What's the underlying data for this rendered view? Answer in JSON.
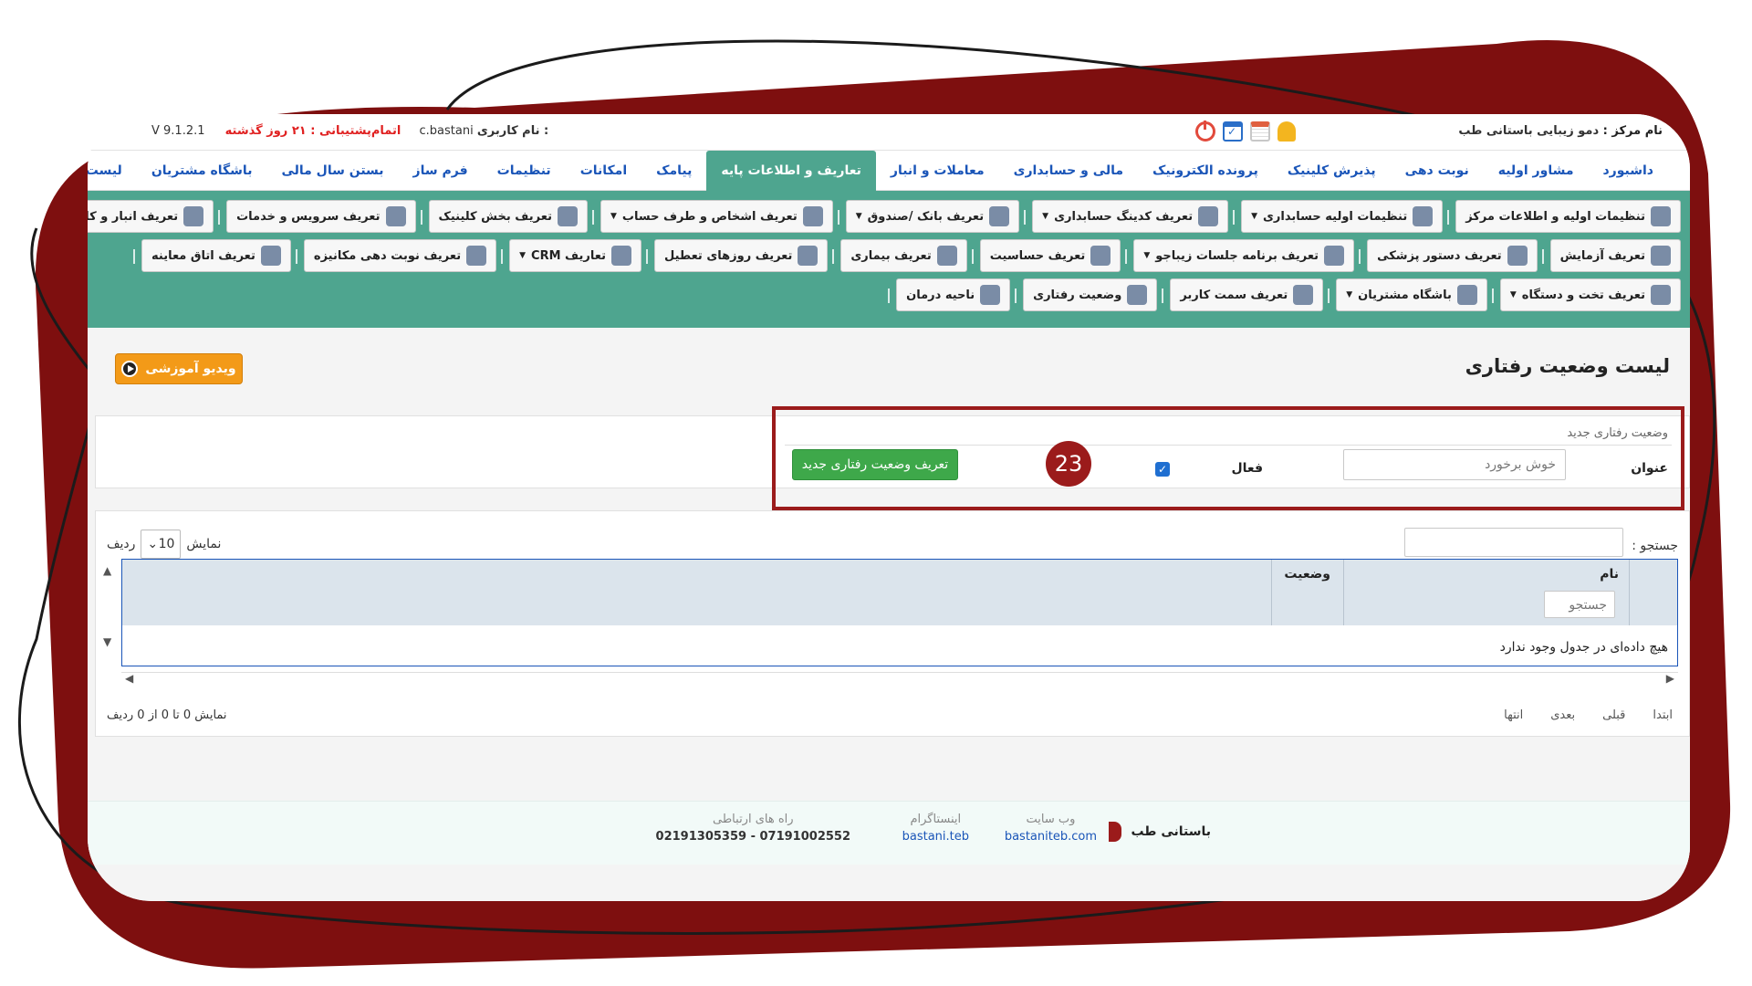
{
  "header": {
    "center_label": "نام مرکز :",
    "center_name": "دمو زیبایی باستانی طب",
    "user_label": "نام کاربری :",
    "username": "c.bastani",
    "support_warning": "اتمام‌پشتیبانی : ۲۱ روز گذشته",
    "version": "V 9.1.2.1",
    "icons": [
      "bell-icon",
      "calendar-icon",
      "calendar-check-icon",
      "power-icon"
    ]
  },
  "main_nav": {
    "items": [
      {
        "label": "داشبورد",
        "active": false
      },
      {
        "label": "مشاور اولیه",
        "active": false
      },
      {
        "label": "نوبت دهی",
        "active": false
      },
      {
        "label": "پذیرش کلینیک",
        "active": false
      },
      {
        "label": "پرونده الکترونیک",
        "active": false
      },
      {
        "label": "مالی و حسابداری",
        "active": false
      },
      {
        "label": "معاملات و انبار",
        "active": false
      },
      {
        "label": "تعاریف و اطلاعات پایه",
        "active": true
      },
      {
        "label": "پیامک",
        "active": false
      },
      {
        "label": "امکانات",
        "active": false
      },
      {
        "label": "تنظیمات",
        "active": false
      },
      {
        "label": "فرم ساز",
        "active": false
      },
      {
        "label": "بستن سال مالی",
        "active": false
      },
      {
        "label": "باشگاه مشتریان",
        "active": false
      },
      {
        "label": "لیست ماژول ها",
        "active": false
      }
    ]
  },
  "toolbar": {
    "row1": [
      {
        "label": "تنظیمات اولیه و اطلاعات مرکز",
        "icon": "building-icon",
        "dropdown": false
      },
      {
        "label": "تنظیمات اولیه حسابداری",
        "icon": "handshake-icon",
        "dropdown": true
      },
      {
        "label": "تعریف کدینگ حسابداری",
        "icon": "handshake-icon",
        "dropdown": true
      },
      {
        "label": "تعریف بانک /صندوق",
        "icon": "bank-icon",
        "dropdown": true
      },
      {
        "label": "تعریف اشخاص و طرف حساب",
        "icon": "people-icon",
        "dropdown": true
      },
      {
        "label": "تعریف بخش کلینیک",
        "icon": "grid-icon",
        "dropdown": false
      },
      {
        "label": "تعریف سرویس و خدمات",
        "icon": "monitor-icon",
        "dropdown": false
      },
      {
        "label": "تعریف انبار و کالا",
        "icon": "box-icon",
        "dropdown": true
      }
    ],
    "row2": [
      {
        "label": "تعریف آزمایش",
        "icon": "flask-icon",
        "dropdown": false
      },
      {
        "label": "تعریف دستور پزشکی",
        "icon": "bottle-icon",
        "dropdown": false
      },
      {
        "label": "تعریف برنامه جلسات زیباجو",
        "icon": "calendar-people-icon",
        "dropdown": true
      },
      {
        "label": "تعریف حساسیت",
        "icon": "allergy-icon",
        "dropdown": false
      },
      {
        "label": "تعریف بیماری",
        "icon": "patient-icon",
        "dropdown": false
      },
      {
        "label": "تعریف روزهای تعطیل",
        "icon": "calendar-icon",
        "dropdown": false
      },
      {
        "label": "تعاریف CRM",
        "icon": "crm-icon",
        "dropdown": true
      },
      {
        "label": "تعریف نوبت دهی مکانیزه",
        "icon": "computer-icon",
        "dropdown": false
      },
      {
        "label": "تعریف اتاق معاینه",
        "icon": "doctor-icon",
        "dropdown": false
      }
    ],
    "row3": [
      {
        "label": "تعریف تخت و دستگاه",
        "icon": "clipboard-icon",
        "dropdown": true
      },
      {
        "label": "باشگاه مشتریان",
        "icon": "group-icon",
        "dropdown": true
      },
      {
        "label": "تعریف سمت کاربر",
        "icon": "user-icon",
        "dropdown": false
      },
      {
        "label": "وضعیت رفتاری",
        "icon": "face-icon",
        "dropdown": false
      },
      {
        "label": "ناحیه درمان",
        "icon": "body-icon",
        "dropdown": false
      }
    ]
  },
  "page": {
    "title": "لیست وضعیت رفتاری",
    "video_button": "ویدیو آموزشی"
  },
  "form": {
    "legend": "وضعیت رفتاری جدید",
    "title_label": "عنوان",
    "title_value": "خوش برخورد",
    "active_label": "فعال",
    "active_checked": true,
    "step_number": "23",
    "submit_label": "تعریف وضعیت رفتاری جدید"
  },
  "table": {
    "search_label": "جستجو :",
    "length_prefix": "نمایش",
    "length_value": "10",
    "length_suffix": "ردیف",
    "columns": [
      "نام",
      "وضعیت"
    ],
    "column_filter_placeholder": "جستجو",
    "empty_message": "هیچ داده‌ای در جدول وجود ندارد",
    "info": "نمایش 0 تا 0 از 0 ردیف",
    "pager": [
      "ابتدا",
      "قبلی",
      "بعدی",
      "انتها"
    ]
  },
  "footer": {
    "brand": "باستانی طب",
    "website_label": "وب سایت",
    "website_value": "bastaniteb.com",
    "instagram_label": "اینستاگرام",
    "instagram_value": "bastani.teb",
    "contact_label": "راه های ارتباطی",
    "contact_value": "07191002552 - 02191305359"
  },
  "colors": {
    "accent": "#4ea58f",
    "frame": "#7e0f0f",
    "nav_link": "#1a55b8",
    "video_button": "#f39a18",
    "submit_button": "#3ea84a",
    "highlight": "#9b1b1b"
  }
}
